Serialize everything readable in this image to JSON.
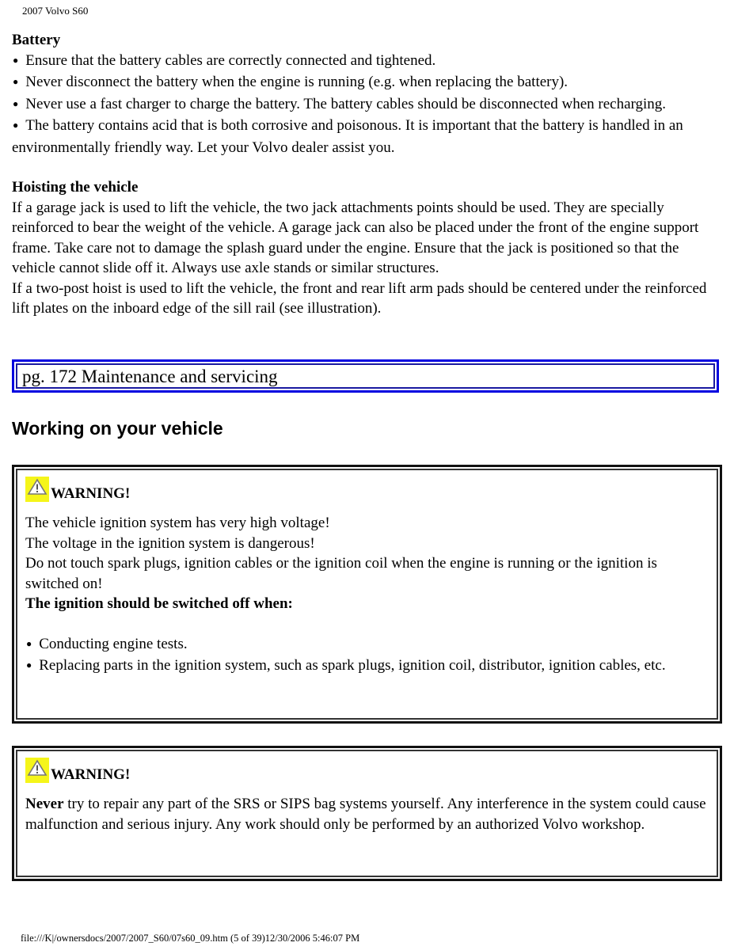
{
  "header": {
    "title": "2007 Volvo S60"
  },
  "battery": {
    "title": "Battery",
    "bullets": [
      "Ensure that the battery cables are correctly connected and tightened.",
      "Never disconnect the battery when the engine is running (e.g. when replacing the battery).",
      "Never use a fast charger to charge the battery. The battery cables should be disconnected when recharging.",
      "The battery contains acid that is both corrosive and poisonous. It is important that the battery is handled in an environmentally friendly way. Let your Volvo dealer assist you."
    ]
  },
  "hoisting": {
    "title": "Hoisting the vehicle",
    "paragraphs": [
      "If a garage jack is used to lift the vehicle, the two jack attachments points should be used. They are specially reinforced to bear the weight of the vehicle. A garage jack can also be placed under the front of the engine support frame. Take care not to damage the splash guard under the engine. Ensure that the jack is positioned so that the vehicle cannot slide off it. Always use axle stands or similar structures.",
      "If a two-post hoist is used to lift the vehicle, the front and rear lift arm pads should be centered under the reinforced lift plates on the inboard edge of the sill rail (see illustration)."
    ]
  },
  "page_ref": {
    "label": "pg. 172 Maintenance and servicing"
  },
  "section": {
    "title": "Working on your vehicle"
  },
  "warning1": {
    "icon": "warning-triangle-icon",
    "label": "WARNING!",
    "lines": [
      "The vehicle ignition system has very high voltage!",
      "The voltage in the ignition system is dangerous!",
      "Do not touch spark plugs, ignition cables or the ignition coil when the engine is running or the ignition is switched on!"
    ],
    "subheading": "The ignition should be switched off when:",
    "bullets": [
      "Conducting engine tests.",
      "Replacing parts in the ignition system, such as spark plugs, ignition coil, distributor, ignition cables, etc."
    ]
  },
  "warning2": {
    "icon": "warning-triangle-icon",
    "label": "WARNING!",
    "lead": "Never",
    "text": " try to repair any part of the SRS or SIPS bag systems yourself. Any interference in the system could cause malfunction and serious injury. Any work should only be performed by an authorized Volvo workshop."
  },
  "footer": {
    "text": "file:///K|/ownersdocs/2007/2007_S60/07s60_09.htm (5 of 39)12/30/2006 5:46:07 PM"
  }
}
